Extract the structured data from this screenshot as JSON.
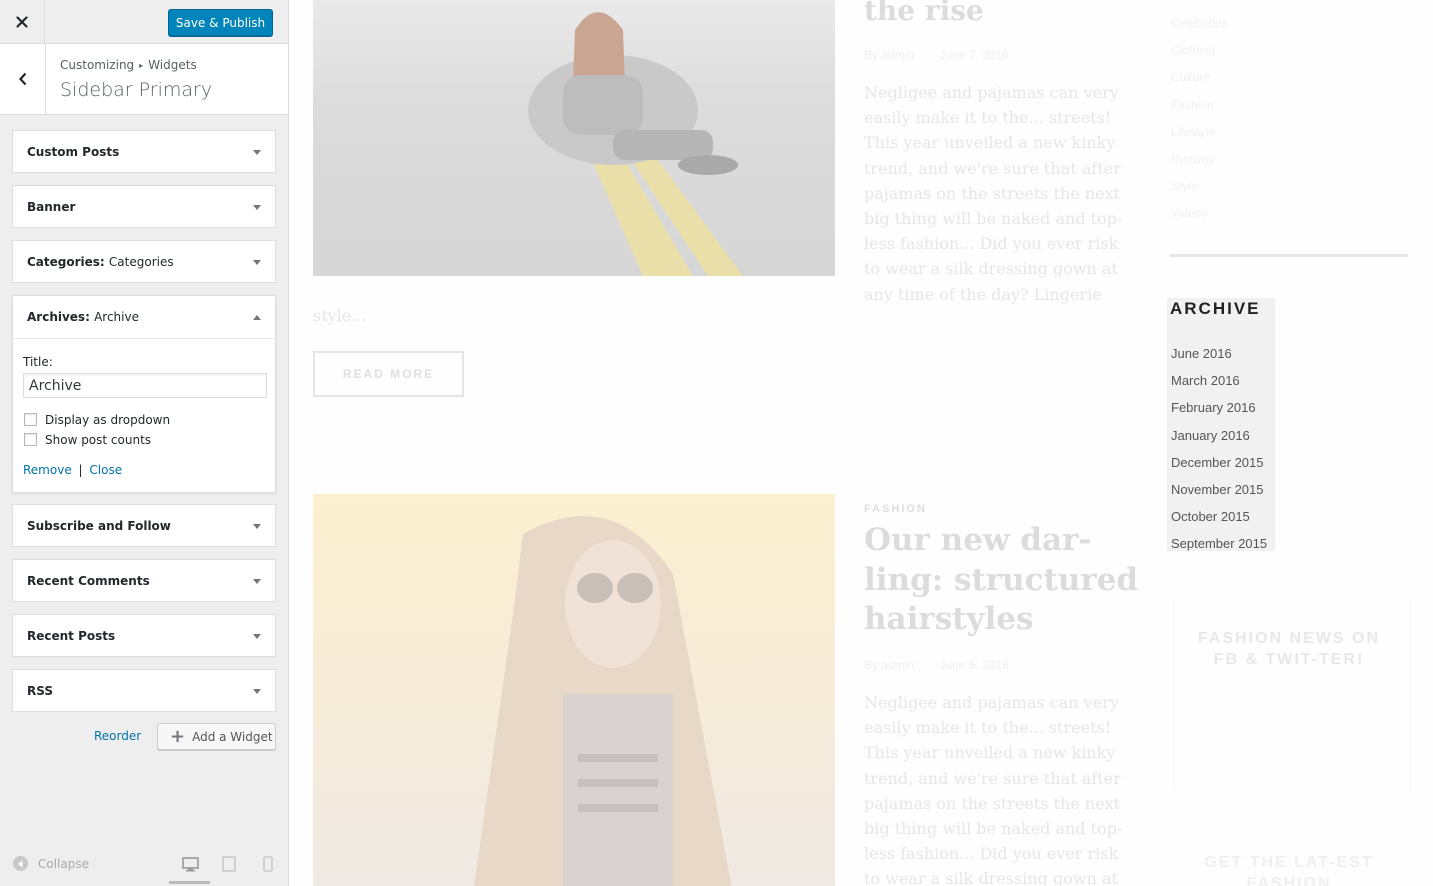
{
  "customizer": {
    "publish_label": "Save & Publish",
    "breadcrumb": [
      "Customizing",
      "Widgets"
    ],
    "breadcrumb_sep": "▸",
    "panel_title": "Sidebar Primary",
    "widgets": [
      {
        "title": "Custom Posts",
        "subtitle": ""
      },
      {
        "title": "Banner",
        "subtitle": ""
      },
      {
        "title": "Categories:",
        "subtitle": "Categories"
      },
      {
        "title": "Archives:",
        "subtitle": "Archive"
      },
      {
        "title": "Subscribe and Follow",
        "subtitle": ""
      },
      {
        "title": "Recent Comments",
        "subtitle": ""
      },
      {
        "title": "Recent Posts",
        "subtitle": ""
      },
      {
        "title": "RSS",
        "subtitle": ""
      }
    ],
    "archive_form": {
      "title_label": "Title:",
      "title_value": "Archive",
      "dropdown_label": "Display as dropdown",
      "dropdown_checked": false,
      "counts_label": "Show post counts",
      "counts_checked": false,
      "remove_label": "Remove",
      "separator": "|",
      "close_label": "Close"
    },
    "reorder_label": "Reorder",
    "add_widget_label": "Add a Widget",
    "collapse_label": "Collapse",
    "accent_color": "#0085ba",
    "devices": [
      "desktop-icon",
      "tablet-icon",
      "mobile-icon"
    ],
    "active_device": "desktop"
  },
  "preview": {
    "post1": {
      "title_tail": "the rise",
      "author": "By admin",
      "date": "June 7, 2016",
      "excerpt": "Negligee and pajamas can very easily make it to the... streets! This year unveiled a new kinky trend, and we're sure that after pajamas on the streets the next big thing will be naked and top-less fashion... Did you ever risk to wear a silk dressing gown at any time of the day? Lingerie",
      "excerpt_tail": "style...",
      "read_more": "READ MORE"
    },
    "post2": {
      "category": "FASHION",
      "title_lines": [
        "Our new dar-",
        "ling: structured",
        "hairstyles"
      ],
      "author": "By admin",
      "date": "June 5, 2016",
      "excerpt": "Negligee and pajamas can very easily make it to the... streets! This year unveiled a new kinky trend, and we're sure that after pajamas on the streets the next big thing will be naked and top-less fashion... Did you ever risk to wear a silk dressing gown at"
    },
    "categories": [
      "Celebrities",
      "Clothing",
      "Culture",
      "Fashion",
      "Lifestyle",
      "Runway",
      "Style",
      "Videos"
    ],
    "archive": {
      "title": "ARCHIVE",
      "items": [
        "June 2016",
        "March 2016",
        "February 2016",
        "January 2016",
        "December 2015",
        "November 2015",
        "October 2015",
        "September 2015"
      ]
    },
    "fashion_news_title": "FASHION NEWS ON FB & TWIT-TER!",
    "latest_title": "GET THE LAT-EST FASHION"
  }
}
